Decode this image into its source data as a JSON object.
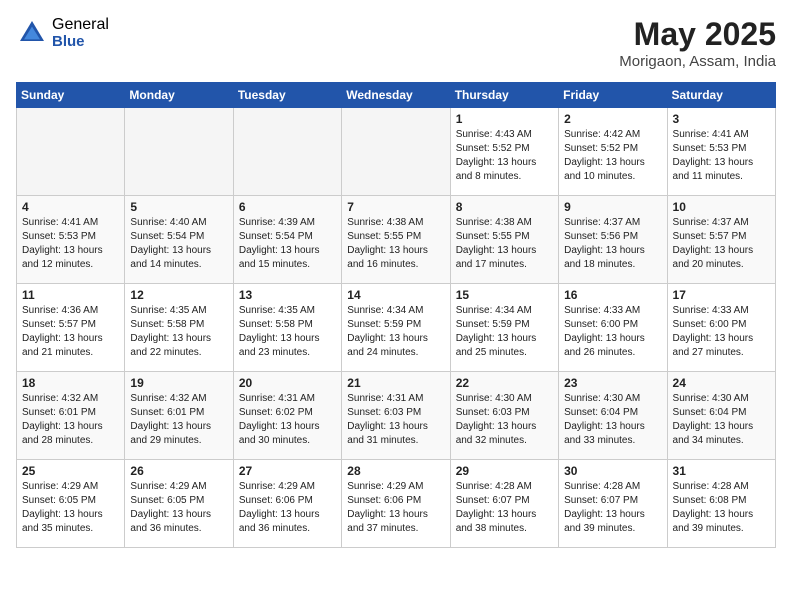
{
  "logo": {
    "general": "General",
    "blue": "Blue"
  },
  "title": "May 2025",
  "subtitle": "Morigaon, Assam, India",
  "days_of_week": [
    "Sunday",
    "Monday",
    "Tuesday",
    "Wednesday",
    "Thursday",
    "Friday",
    "Saturday"
  ],
  "weeks": [
    [
      {
        "day": "",
        "info": ""
      },
      {
        "day": "",
        "info": ""
      },
      {
        "day": "",
        "info": ""
      },
      {
        "day": "",
        "info": ""
      },
      {
        "day": "1",
        "info": "Sunrise: 4:43 AM\nSunset: 5:52 PM\nDaylight: 13 hours\nand 8 minutes."
      },
      {
        "day": "2",
        "info": "Sunrise: 4:42 AM\nSunset: 5:52 PM\nDaylight: 13 hours\nand 10 minutes."
      },
      {
        "day": "3",
        "info": "Sunrise: 4:41 AM\nSunset: 5:53 PM\nDaylight: 13 hours\nand 11 minutes."
      }
    ],
    [
      {
        "day": "4",
        "info": "Sunrise: 4:41 AM\nSunset: 5:53 PM\nDaylight: 13 hours\nand 12 minutes."
      },
      {
        "day": "5",
        "info": "Sunrise: 4:40 AM\nSunset: 5:54 PM\nDaylight: 13 hours\nand 14 minutes."
      },
      {
        "day": "6",
        "info": "Sunrise: 4:39 AM\nSunset: 5:54 PM\nDaylight: 13 hours\nand 15 minutes."
      },
      {
        "day": "7",
        "info": "Sunrise: 4:38 AM\nSunset: 5:55 PM\nDaylight: 13 hours\nand 16 minutes."
      },
      {
        "day": "8",
        "info": "Sunrise: 4:38 AM\nSunset: 5:55 PM\nDaylight: 13 hours\nand 17 minutes."
      },
      {
        "day": "9",
        "info": "Sunrise: 4:37 AM\nSunset: 5:56 PM\nDaylight: 13 hours\nand 18 minutes."
      },
      {
        "day": "10",
        "info": "Sunrise: 4:37 AM\nSunset: 5:57 PM\nDaylight: 13 hours\nand 20 minutes."
      }
    ],
    [
      {
        "day": "11",
        "info": "Sunrise: 4:36 AM\nSunset: 5:57 PM\nDaylight: 13 hours\nand 21 minutes."
      },
      {
        "day": "12",
        "info": "Sunrise: 4:35 AM\nSunset: 5:58 PM\nDaylight: 13 hours\nand 22 minutes."
      },
      {
        "day": "13",
        "info": "Sunrise: 4:35 AM\nSunset: 5:58 PM\nDaylight: 13 hours\nand 23 minutes."
      },
      {
        "day": "14",
        "info": "Sunrise: 4:34 AM\nSunset: 5:59 PM\nDaylight: 13 hours\nand 24 minutes."
      },
      {
        "day": "15",
        "info": "Sunrise: 4:34 AM\nSunset: 5:59 PM\nDaylight: 13 hours\nand 25 minutes."
      },
      {
        "day": "16",
        "info": "Sunrise: 4:33 AM\nSunset: 6:00 PM\nDaylight: 13 hours\nand 26 minutes."
      },
      {
        "day": "17",
        "info": "Sunrise: 4:33 AM\nSunset: 6:00 PM\nDaylight: 13 hours\nand 27 minutes."
      }
    ],
    [
      {
        "day": "18",
        "info": "Sunrise: 4:32 AM\nSunset: 6:01 PM\nDaylight: 13 hours\nand 28 minutes."
      },
      {
        "day": "19",
        "info": "Sunrise: 4:32 AM\nSunset: 6:01 PM\nDaylight: 13 hours\nand 29 minutes."
      },
      {
        "day": "20",
        "info": "Sunrise: 4:31 AM\nSunset: 6:02 PM\nDaylight: 13 hours\nand 30 minutes."
      },
      {
        "day": "21",
        "info": "Sunrise: 4:31 AM\nSunset: 6:03 PM\nDaylight: 13 hours\nand 31 minutes."
      },
      {
        "day": "22",
        "info": "Sunrise: 4:30 AM\nSunset: 6:03 PM\nDaylight: 13 hours\nand 32 minutes."
      },
      {
        "day": "23",
        "info": "Sunrise: 4:30 AM\nSunset: 6:04 PM\nDaylight: 13 hours\nand 33 minutes."
      },
      {
        "day": "24",
        "info": "Sunrise: 4:30 AM\nSunset: 6:04 PM\nDaylight: 13 hours\nand 34 minutes."
      }
    ],
    [
      {
        "day": "25",
        "info": "Sunrise: 4:29 AM\nSunset: 6:05 PM\nDaylight: 13 hours\nand 35 minutes."
      },
      {
        "day": "26",
        "info": "Sunrise: 4:29 AM\nSunset: 6:05 PM\nDaylight: 13 hours\nand 36 minutes."
      },
      {
        "day": "27",
        "info": "Sunrise: 4:29 AM\nSunset: 6:06 PM\nDaylight: 13 hours\nand 36 minutes."
      },
      {
        "day": "28",
        "info": "Sunrise: 4:29 AM\nSunset: 6:06 PM\nDaylight: 13 hours\nand 37 minutes."
      },
      {
        "day": "29",
        "info": "Sunrise: 4:28 AM\nSunset: 6:07 PM\nDaylight: 13 hours\nand 38 minutes."
      },
      {
        "day": "30",
        "info": "Sunrise: 4:28 AM\nSunset: 6:07 PM\nDaylight: 13 hours\nand 39 minutes."
      },
      {
        "day": "31",
        "info": "Sunrise: 4:28 AM\nSunset: 6:08 PM\nDaylight: 13 hours\nand 39 minutes."
      }
    ]
  ]
}
